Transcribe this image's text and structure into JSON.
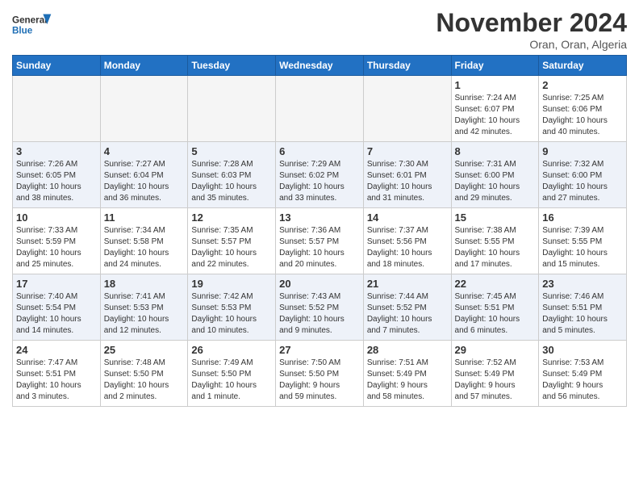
{
  "header": {
    "logo_general": "General",
    "logo_blue": "Blue",
    "month_title": "November 2024",
    "location": "Oran, Oran, Algeria"
  },
  "weekdays": [
    "Sunday",
    "Monday",
    "Tuesday",
    "Wednesday",
    "Thursday",
    "Friday",
    "Saturday"
  ],
  "weeks": [
    [
      {
        "day": "",
        "info": ""
      },
      {
        "day": "",
        "info": ""
      },
      {
        "day": "",
        "info": ""
      },
      {
        "day": "",
        "info": ""
      },
      {
        "day": "",
        "info": ""
      },
      {
        "day": "1",
        "info": "Sunrise: 7:24 AM\nSunset: 6:07 PM\nDaylight: 10 hours\nand 42 minutes."
      },
      {
        "day": "2",
        "info": "Sunrise: 7:25 AM\nSunset: 6:06 PM\nDaylight: 10 hours\nand 40 minutes."
      }
    ],
    [
      {
        "day": "3",
        "info": "Sunrise: 7:26 AM\nSunset: 6:05 PM\nDaylight: 10 hours\nand 38 minutes."
      },
      {
        "day": "4",
        "info": "Sunrise: 7:27 AM\nSunset: 6:04 PM\nDaylight: 10 hours\nand 36 minutes."
      },
      {
        "day": "5",
        "info": "Sunrise: 7:28 AM\nSunset: 6:03 PM\nDaylight: 10 hours\nand 35 minutes."
      },
      {
        "day": "6",
        "info": "Sunrise: 7:29 AM\nSunset: 6:02 PM\nDaylight: 10 hours\nand 33 minutes."
      },
      {
        "day": "7",
        "info": "Sunrise: 7:30 AM\nSunset: 6:01 PM\nDaylight: 10 hours\nand 31 minutes."
      },
      {
        "day": "8",
        "info": "Sunrise: 7:31 AM\nSunset: 6:00 PM\nDaylight: 10 hours\nand 29 minutes."
      },
      {
        "day": "9",
        "info": "Sunrise: 7:32 AM\nSunset: 6:00 PM\nDaylight: 10 hours\nand 27 minutes."
      }
    ],
    [
      {
        "day": "10",
        "info": "Sunrise: 7:33 AM\nSunset: 5:59 PM\nDaylight: 10 hours\nand 25 minutes."
      },
      {
        "day": "11",
        "info": "Sunrise: 7:34 AM\nSunset: 5:58 PM\nDaylight: 10 hours\nand 24 minutes."
      },
      {
        "day": "12",
        "info": "Sunrise: 7:35 AM\nSunset: 5:57 PM\nDaylight: 10 hours\nand 22 minutes."
      },
      {
        "day": "13",
        "info": "Sunrise: 7:36 AM\nSunset: 5:57 PM\nDaylight: 10 hours\nand 20 minutes."
      },
      {
        "day": "14",
        "info": "Sunrise: 7:37 AM\nSunset: 5:56 PM\nDaylight: 10 hours\nand 18 minutes."
      },
      {
        "day": "15",
        "info": "Sunrise: 7:38 AM\nSunset: 5:55 PM\nDaylight: 10 hours\nand 17 minutes."
      },
      {
        "day": "16",
        "info": "Sunrise: 7:39 AM\nSunset: 5:55 PM\nDaylight: 10 hours\nand 15 minutes."
      }
    ],
    [
      {
        "day": "17",
        "info": "Sunrise: 7:40 AM\nSunset: 5:54 PM\nDaylight: 10 hours\nand 14 minutes."
      },
      {
        "day": "18",
        "info": "Sunrise: 7:41 AM\nSunset: 5:53 PM\nDaylight: 10 hours\nand 12 minutes."
      },
      {
        "day": "19",
        "info": "Sunrise: 7:42 AM\nSunset: 5:53 PM\nDaylight: 10 hours\nand 10 minutes."
      },
      {
        "day": "20",
        "info": "Sunrise: 7:43 AM\nSunset: 5:52 PM\nDaylight: 10 hours\nand 9 minutes."
      },
      {
        "day": "21",
        "info": "Sunrise: 7:44 AM\nSunset: 5:52 PM\nDaylight: 10 hours\nand 7 minutes."
      },
      {
        "day": "22",
        "info": "Sunrise: 7:45 AM\nSunset: 5:51 PM\nDaylight: 10 hours\nand 6 minutes."
      },
      {
        "day": "23",
        "info": "Sunrise: 7:46 AM\nSunset: 5:51 PM\nDaylight: 10 hours\nand 5 minutes."
      }
    ],
    [
      {
        "day": "24",
        "info": "Sunrise: 7:47 AM\nSunset: 5:51 PM\nDaylight: 10 hours\nand 3 minutes."
      },
      {
        "day": "25",
        "info": "Sunrise: 7:48 AM\nSunset: 5:50 PM\nDaylight: 10 hours\nand 2 minutes."
      },
      {
        "day": "26",
        "info": "Sunrise: 7:49 AM\nSunset: 5:50 PM\nDaylight: 10 hours\nand 1 minute."
      },
      {
        "day": "27",
        "info": "Sunrise: 7:50 AM\nSunset: 5:50 PM\nDaylight: 9 hours\nand 59 minutes."
      },
      {
        "day": "28",
        "info": "Sunrise: 7:51 AM\nSunset: 5:49 PM\nDaylight: 9 hours\nand 58 minutes."
      },
      {
        "day": "29",
        "info": "Sunrise: 7:52 AM\nSunset: 5:49 PM\nDaylight: 9 hours\nand 57 minutes."
      },
      {
        "day": "30",
        "info": "Sunrise: 7:53 AM\nSunset: 5:49 PM\nDaylight: 9 hours\nand 56 minutes."
      }
    ]
  ]
}
